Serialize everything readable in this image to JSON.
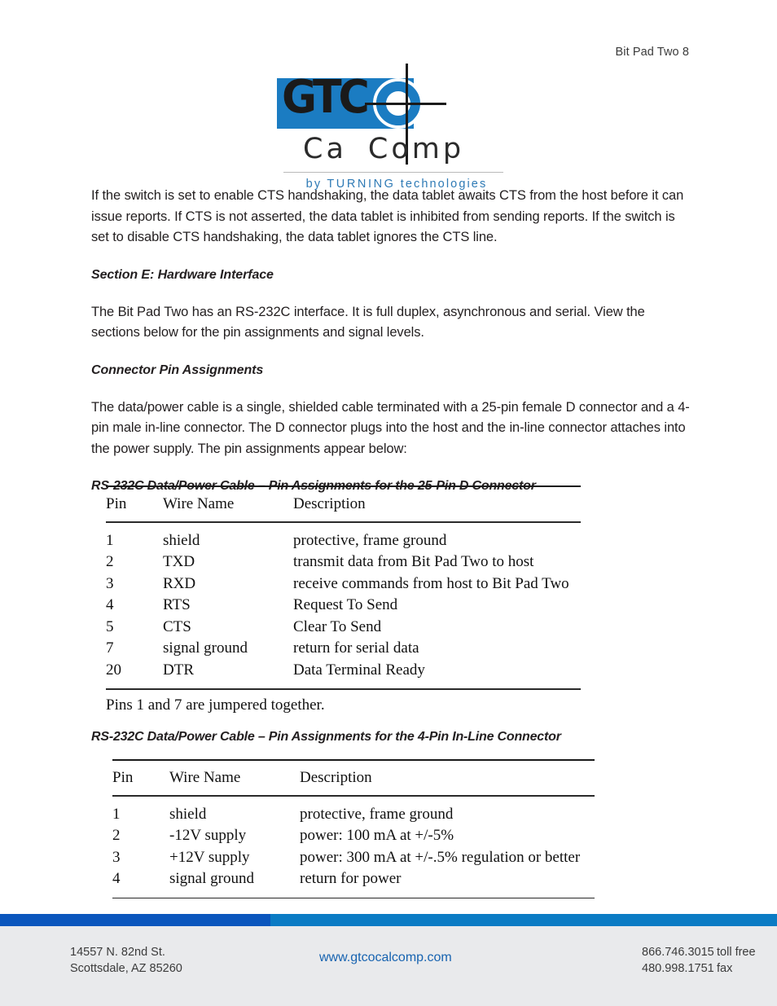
{
  "header": {
    "running_head": "Bit Pad Two 8"
  },
  "logo": {
    "mark_text": "GTC",
    "wordmark_left": "Ca",
    "wordmark_right": "Comp",
    "tagline_by": "by",
    "tagline_turning": "TURNING",
    "tagline_technologies": "technologies",
    "brand_blue": "#1b7cc2",
    "tagline_blue": "#2e7ab5"
  },
  "body": {
    "paragraph_1": "If the switch is set to enable CTS handshaking, the data tablet awaits CTS from the host before it can issue reports.  If CTS is not asserted, the data tablet is inhibited from sending reports.  If the switch is set to disable CTS handshaking, the data tablet ignores the CTS line.",
    "section_e_heading": "Section E: Hardware Interface",
    "paragraph_2": "The Bit Pad Two has an RS-232C interface.  It is full duplex, asynchronous and serial.  View the sections below for the pin assignments and signal levels.",
    "connector_heading": "Connector Pin Assignments",
    "paragraph_3": "The data/power cable is a single, shielded cable terminated with a 25-pin female D connector and a 4-pin male in-line connector.  The D connector plugs into the host and the in-line connector attaches into the power supply.  The pin assignments appear below:"
  },
  "table_1": {
    "caption": "RS-232C Data/Power Cable – Pin Assignments for the 25-Pin D Connector",
    "columns": [
      "Pin",
      "Wire Name",
      "Description"
    ],
    "rows": [
      [
        "1",
        "shield",
        "protective, frame ground"
      ],
      [
        "2",
        "TXD",
        "transmit data from Bit Pad Two to host"
      ],
      [
        "3",
        "RXD",
        "receive commands from host to Bit Pad Two"
      ],
      [
        "4",
        "RTS",
        "Request To Send"
      ],
      [
        "5",
        "CTS",
        "Clear To Send"
      ],
      [
        "7",
        "signal ground",
        "return for serial data"
      ],
      [
        "20",
        "DTR",
        "Data Terminal Ready"
      ]
    ],
    "note": "Pins 1 and 7 are jumpered together."
  },
  "table_2": {
    "caption": "RS-232C Data/Power Cable – Pin Assignments for the 4-Pin In-Line Connector",
    "columns": [
      "Pin",
      "Wire Name",
      "Description"
    ],
    "rows": [
      [
        "1",
        "shield",
        "protective, frame ground"
      ],
      [
        "2",
        "-12V supply",
        "power:  100 mA at +/-5%"
      ],
      [
        "3",
        "+12V supply",
        "power:  300 mA at +/-.5% regulation or better"
      ],
      [
        "4",
        "signal ground",
        "return for power"
      ]
    ]
  },
  "footer": {
    "address_line_1": "14557 N. 82nd St.",
    "address_line_2": "Scottsdale, AZ 85260",
    "website": "www.gtcocalcomp.com",
    "phone_1_number": "866.746.3015",
    "phone_1_label": "toll free",
    "phone_2_number": "480.998.1751",
    "phone_2_label": "fax",
    "bar_dark": "#0b56bd",
    "bar_light": "#0b7bc4",
    "background": "#e9eaec",
    "link_color": "#1763b0"
  }
}
